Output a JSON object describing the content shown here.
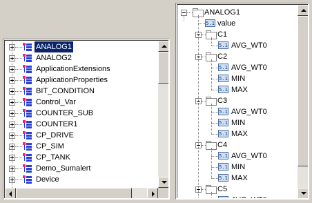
{
  "left_tree": {
    "items": [
      {
        "label": "ANALOG1",
        "selected": true
      },
      {
        "label": "ANALOG2"
      },
      {
        "label": "ApplicationExtensions"
      },
      {
        "label": "ApplicationProperties"
      },
      {
        "label": "BIT_CONDITION"
      },
      {
        "label": "Control_Var"
      },
      {
        "label": "COUNTER_SUB"
      },
      {
        "label": "COUNTER1"
      },
      {
        "label": "CP_DRIVE"
      },
      {
        "label": "CP_SIM"
      },
      {
        "label": "CP_TANK"
      },
      {
        "label": "Demo_Sumalert"
      },
      {
        "label": "Device"
      }
    ]
  },
  "right_tree": {
    "root": "ANALOG1",
    "value_icon_text": "5.1",
    "value": "value",
    "groups": [
      {
        "name": "C1",
        "children": [
          "AVG_WT0"
        ]
      },
      {
        "name": "C2",
        "children": [
          "AVG_WT0",
          "MIN",
          "MAX"
        ]
      },
      {
        "name": "C3",
        "children": [
          "AVG_WT0",
          "MIN",
          "MAX"
        ]
      },
      {
        "name": "C4",
        "children": [
          "AVG_WT0",
          "MIN",
          "MAX"
        ]
      },
      {
        "name": "C5",
        "children": [
          "AVG_WT0"
        ]
      }
    ]
  },
  "colors": {
    "selection": "#0a246a",
    "window_bg": "#d4d0c8"
  }
}
